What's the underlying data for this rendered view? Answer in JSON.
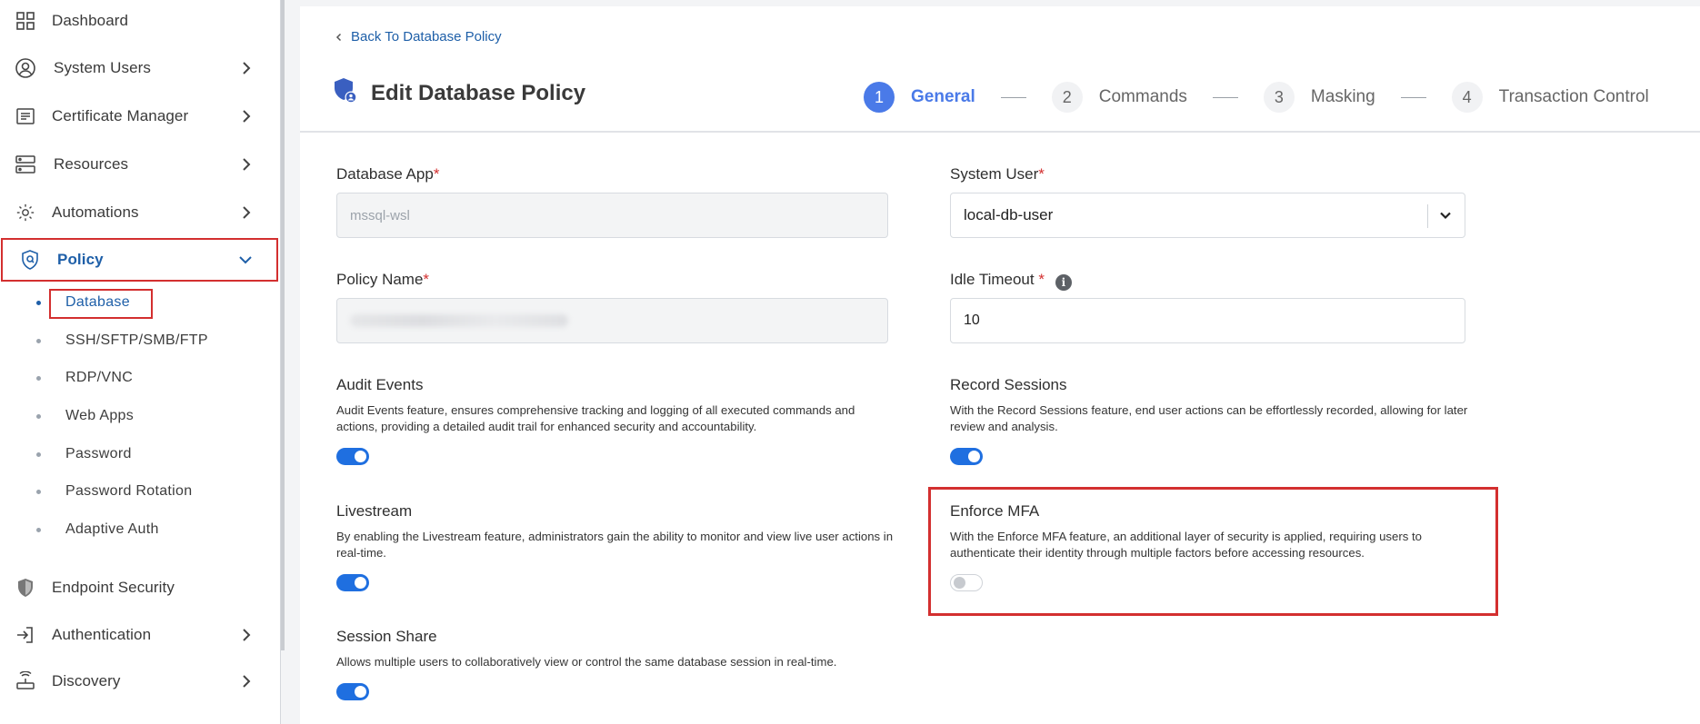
{
  "sidebar": {
    "items": [
      {
        "label": "Dashboard"
      },
      {
        "label": "System Users"
      },
      {
        "label": "Certificate Manager"
      },
      {
        "label": "Resources"
      },
      {
        "label": "Automations"
      },
      {
        "label": "Policy"
      },
      {
        "label": "Endpoint Security"
      },
      {
        "label": "Authentication"
      },
      {
        "label": "Discovery"
      }
    ],
    "policy_sub": [
      {
        "label": "Database"
      },
      {
        "label": "SSH/SFTP/SMB/FTP"
      },
      {
        "label": "RDP/VNC"
      },
      {
        "label": "Web Apps"
      },
      {
        "label": "Password"
      },
      {
        "label": "Password Rotation"
      },
      {
        "label": "Adaptive Auth"
      }
    ]
  },
  "header": {
    "back_label": "Back To Database Policy",
    "title": "Edit Database Policy",
    "steps": [
      {
        "num": "1",
        "label": "General"
      },
      {
        "num": "2",
        "label": "Commands"
      },
      {
        "num": "3",
        "label": "Masking"
      },
      {
        "num": "4",
        "label": "Transaction Control"
      }
    ]
  },
  "form": {
    "database_app": {
      "label": "Database App",
      "value": "mssql-wsl"
    },
    "system_user": {
      "label": "System User",
      "value": "local-db-user"
    },
    "policy_name": {
      "label": "Policy Name",
      "value": ""
    },
    "idle_timeout": {
      "label": "Idle Timeout ",
      "value": "10"
    },
    "required_mark": "*",
    "info_glyph": "i"
  },
  "features": {
    "audit_events": {
      "title": "Audit Events",
      "desc": "Audit Events feature, ensures comprehensive tracking and logging of all executed commands and actions, providing a detailed audit trail for enhanced security and accountability.",
      "enabled": true
    },
    "record_sessions": {
      "title": "Record Sessions",
      "desc": "With the Record Sessions feature, end user actions can be effortlessly recorded, allowing for later review and analysis.",
      "enabled": true
    },
    "livestream": {
      "title": "Livestream",
      "desc": "By enabling the Livestream feature, administrators gain the ability to monitor and view live user actions in real-time.",
      "enabled": true
    },
    "enforce_mfa": {
      "title": "Enforce MFA",
      "desc": "With the Enforce MFA feature, an additional layer of security is applied, requiring users to authenticate their identity through multiple factors before accessing resources.",
      "enabled": false
    },
    "session_share": {
      "title": "Session Share",
      "desc": "Allows multiple users to collaboratively view or control the same database session in real-time.",
      "enabled": true
    }
  },
  "colors": {
    "accent": "#1e5fa8",
    "step_active": "#4a7ae8",
    "toggle_on": "#1f6fe0",
    "highlight": "#d32f2f"
  }
}
